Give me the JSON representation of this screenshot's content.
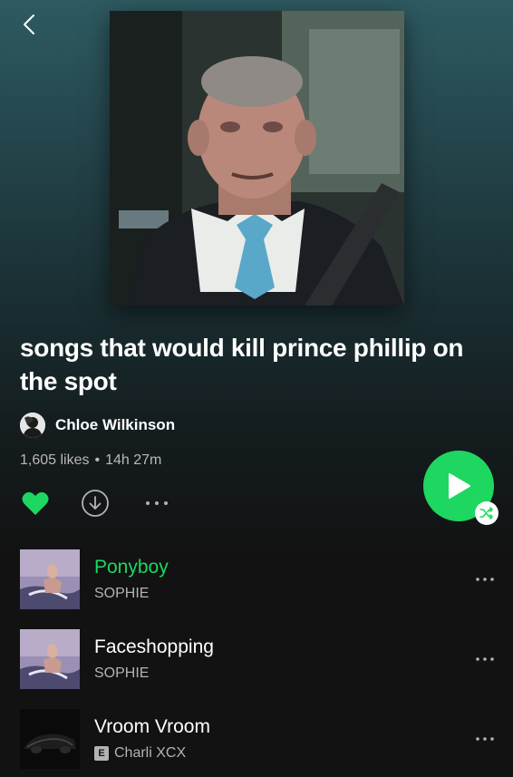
{
  "header": {
    "back_icon": "chevron-left-icon"
  },
  "playlist": {
    "cover_alt": "Elderly man in suit with light blue tie seated in a car",
    "title": "songs that would kill prince phillip on the spot",
    "owner": "Chloe Wilkinson",
    "likes": "1,605 likes",
    "separator": "•",
    "duration": "14h 27m"
  },
  "actions": {
    "liked": true,
    "heart_icon": "heart-filled-icon",
    "download_icon": "download-icon",
    "more_icon": "more-horizontal-icon",
    "play_icon": "play-icon",
    "shuffle_icon": "shuffle-icon"
  },
  "colors": {
    "accent": "#1ed760",
    "background": "#121212",
    "header_gradient_top": "#2e5a61",
    "secondary_text": "#b3b3b3"
  },
  "tracks": [
    {
      "title": "Ponyboy",
      "artist": "SOPHIE",
      "explicit": false,
      "playing": true,
      "art": "sophie-cover"
    },
    {
      "title": "Faceshopping",
      "artist": "SOPHIE",
      "explicit": false,
      "playing": false,
      "art": "sophie-cover"
    },
    {
      "title": "Vroom Vroom",
      "artist": "Charli XCX",
      "explicit": true,
      "explicit_label": "E",
      "playing": false,
      "art": "charli-car-cover"
    }
  ]
}
